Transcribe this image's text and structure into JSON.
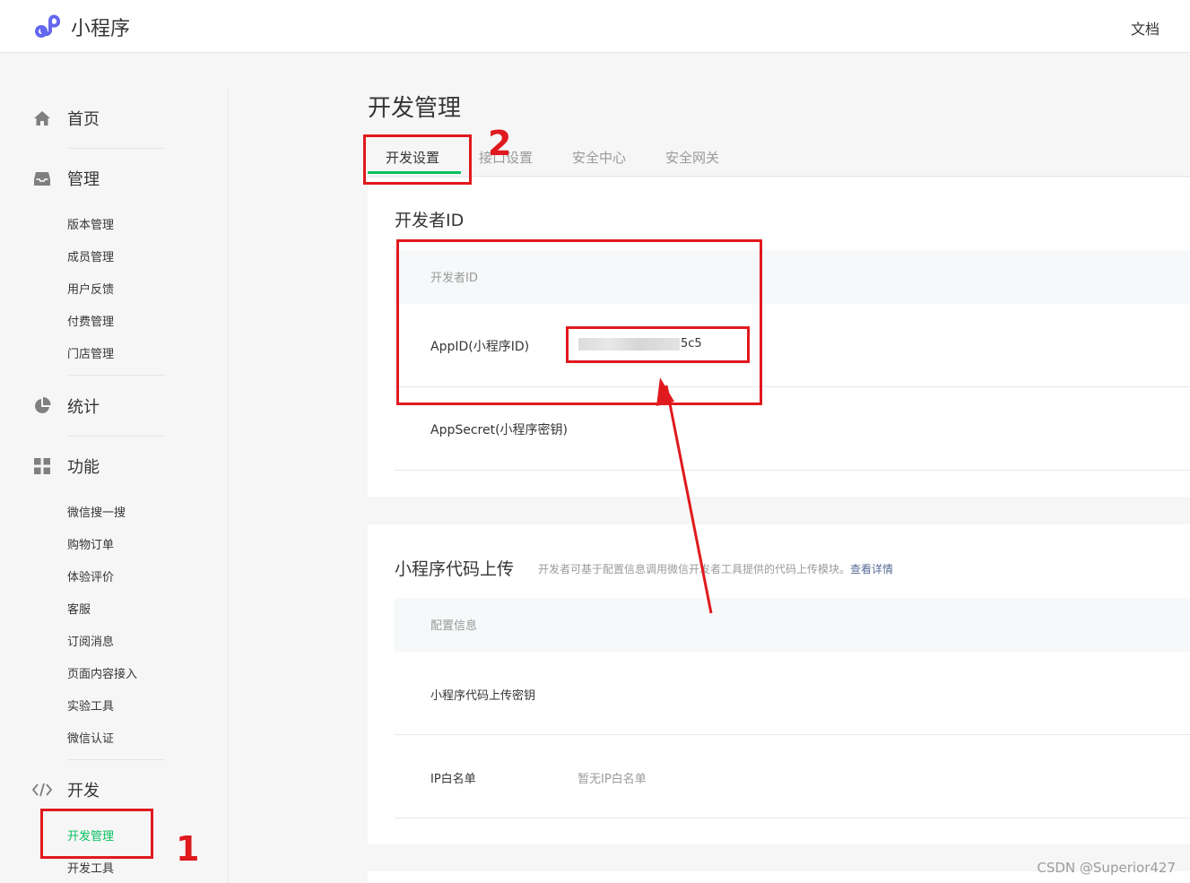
{
  "header": {
    "app_name": "小程序",
    "docs": "文档"
  },
  "sidebar": {
    "home": "首页",
    "manage": "管理",
    "manage_items": [
      "版本管理",
      "成员管理",
      "用户反馈",
      "付费管理",
      "门店管理"
    ],
    "stats": "统计",
    "features": "功能",
    "feature_items": [
      "微信搜一搜",
      "购物订单",
      "体验评价",
      "客服",
      "订阅消息",
      "页面内容接入",
      "实验工具",
      "微信认证"
    ],
    "dev": "开发",
    "dev_items": [
      "开发管理",
      "开发工具"
    ]
  },
  "main": {
    "title": "开发管理",
    "tabs": [
      "开发设置",
      "接口设置",
      "安全中心",
      "安全网关"
    ],
    "dev_id_card": {
      "title": "开发者ID",
      "table_header": "开发者ID",
      "appid_label": "AppID(小程序ID)",
      "appid_value_suffix": "5c5",
      "appsecret_label": "AppSecret(小程序密钥)"
    },
    "upload_card": {
      "title": "小程序代码上传",
      "desc": "开发者可基于配置信息调用微信开发者工具提供的代码上传模块。",
      "desc_link": "查看详情",
      "table_header": "配置信息",
      "upload_key_label": "小程序代码上传密钥",
      "ip_label": "IP白名单",
      "ip_value": "暂无IP白名单"
    }
  },
  "annotations": {
    "one": "1",
    "two": "2"
  },
  "watermark": "CSDN @Superior427",
  "colors": {
    "accent": "#07c160",
    "annotation": "#e0191e",
    "link": "#576b95"
  }
}
